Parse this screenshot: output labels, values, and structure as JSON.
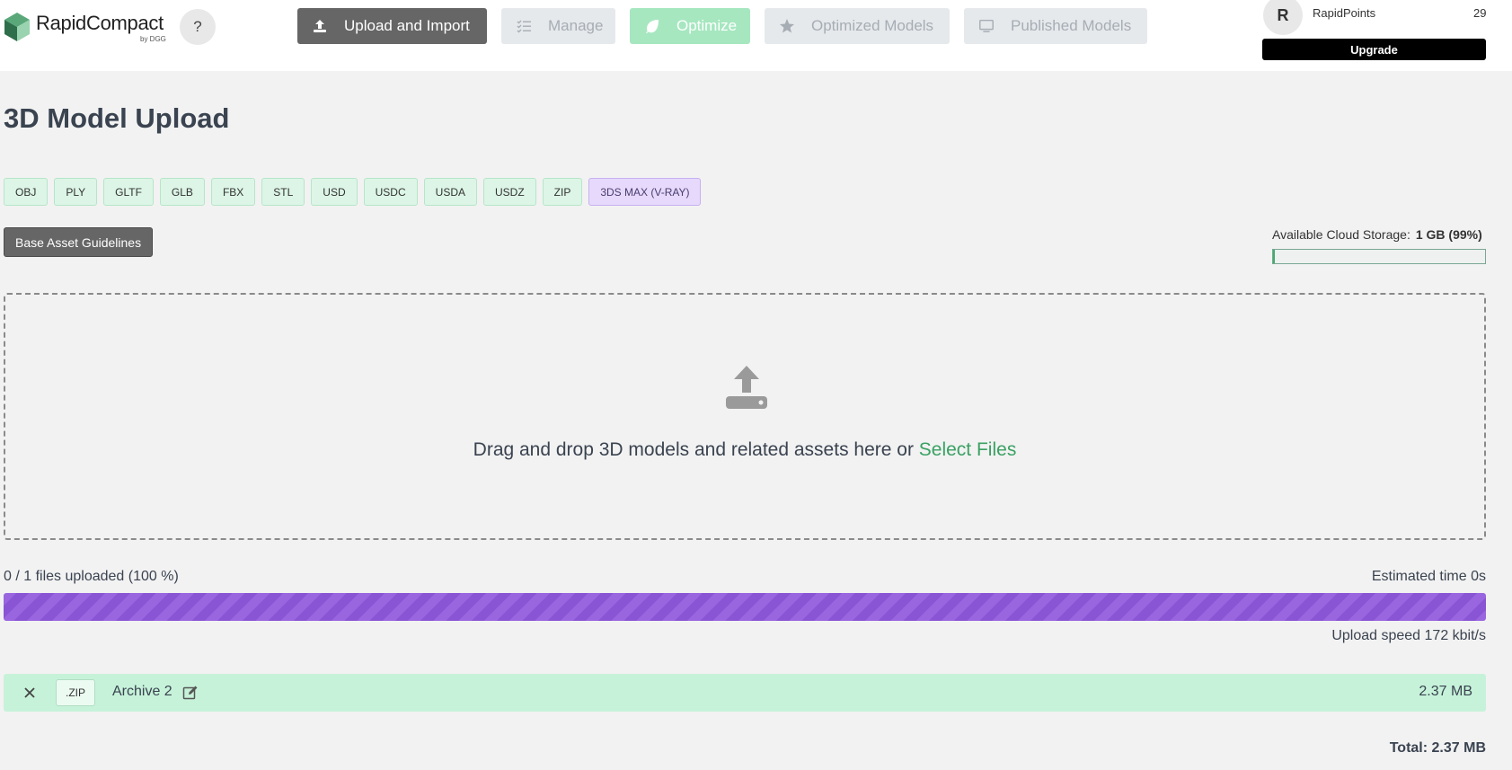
{
  "header": {
    "logo": {
      "name": "RapidCompact",
      "sub": "by DGG"
    },
    "help_label": "?",
    "nav": [
      {
        "label": "Upload and Import",
        "icon": "upload-icon"
      },
      {
        "label": "Manage",
        "icon": "checklist-icon"
      },
      {
        "label": "Optimize",
        "icon": "leaf-icon"
      },
      {
        "label": "Optimized Models",
        "icon": "star-icon"
      },
      {
        "label": "Published Models",
        "icon": "monitor-icon"
      }
    ],
    "user": {
      "initial": "R",
      "points_label": "RapidPoints",
      "points_value": "29",
      "upgrade_label": "Upgrade"
    }
  },
  "page": {
    "title": "3D Model Upload",
    "formats": [
      "OBJ",
      "PLY",
      "GLTF",
      "GLB",
      "FBX",
      "STL",
      "USD",
      "USDC",
      "USDA",
      "USDZ",
      "ZIP",
      "3DS MAX (V-RAY)"
    ],
    "guidelines_label": "Base Asset Guidelines",
    "storage": {
      "label": "Available Cloud Storage:",
      "value": "1 GB (99%)",
      "used_fraction": 0.01
    },
    "dropzone": {
      "text": "Drag and drop 3D models and related assets here or",
      "link": "Select Files"
    },
    "upload": {
      "count_text": "0 / 1 files uploaded (100 %)",
      "estimated_time": "Estimated time 0s",
      "progress_percent": 100,
      "speed": "Upload speed 172 kbit/s"
    },
    "file": {
      "ext": ".ZIP",
      "name": "Archive 2",
      "size": "2.37 MB"
    },
    "total": "Total: 2.37 MB"
  },
  "colors": {
    "accent_green": "#3aa163",
    "progress_purple": "#9966e0",
    "file_row_bg": "#c6f2d9"
  }
}
